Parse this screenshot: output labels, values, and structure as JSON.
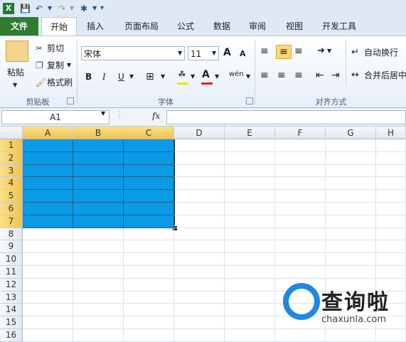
{
  "quick_access": {
    "app_icon": "excel-icon",
    "save_icon": "save-icon",
    "undo_icon": "undo-icon",
    "redo_icon": "redo-icon",
    "tool_icon": "tools-icon",
    "customize_icon": "dropdown-icon"
  },
  "tabs": [
    {
      "label": "文件"
    },
    {
      "label": "开始"
    },
    {
      "label": "插入"
    },
    {
      "label": "页面布局"
    },
    {
      "label": "公式"
    },
    {
      "label": "数据"
    },
    {
      "label": "审阅"
    },
    {
      "label": "视图"
    },
    {
      "label": "开发工具"
    }
  ],
  "clipboard": {
    "paste_label": "粘贴",
    "cut_label": "剪切",
    "copy_label": "复制",
    "painter_label": "格式刷",
    "group_label": "剪贴板"
  },
  "font": {
    "family": "宋体",
    "size": "11",
    "grow": "A",
    "shrink": "A",
    "bold": "B",
    "italic": "I",
    "underline": "U",
    "phonetic": "wén",
    "group_label": "字体",
    "fill_color": "#f2e600",
    "font_color": "#e02020"
  },
  "alignment": {
    "wrap_label": "自动换行",
    "merge_label": "合并后居中",
    "group_label": "对齐方式"
  },
  "formula_bar": {
    "cell_ref": "A1",
    "fx": "fx",
    "value": ""
  },
  "sheet": {
    "columns": [
      "A",
      "B",
      "C",
      "D",
      "E",
      "F",
      "G",
      "H"
    ],
    "rows": [
      "1",
      "2",
      "3",
      "4",
      "5",
      "6",
      "7",
      "8",
      "9",
      "10",
      "11",
      "12",
      "13",
      "14",
      "15",
      "16"
    ],
    "selected_columns": [
      "A",
      "B",
      "C"
    ],
    "selected_rows": [
      "1",
      "2",
      "3",
      "4",
      "5",
      "6",
      "7"
    ],
    "fill_color": "#0b9ae6"
  },
  "watermark": {
    "text": "查询啦",
    "url": "chaxunla.com"
  }
}
